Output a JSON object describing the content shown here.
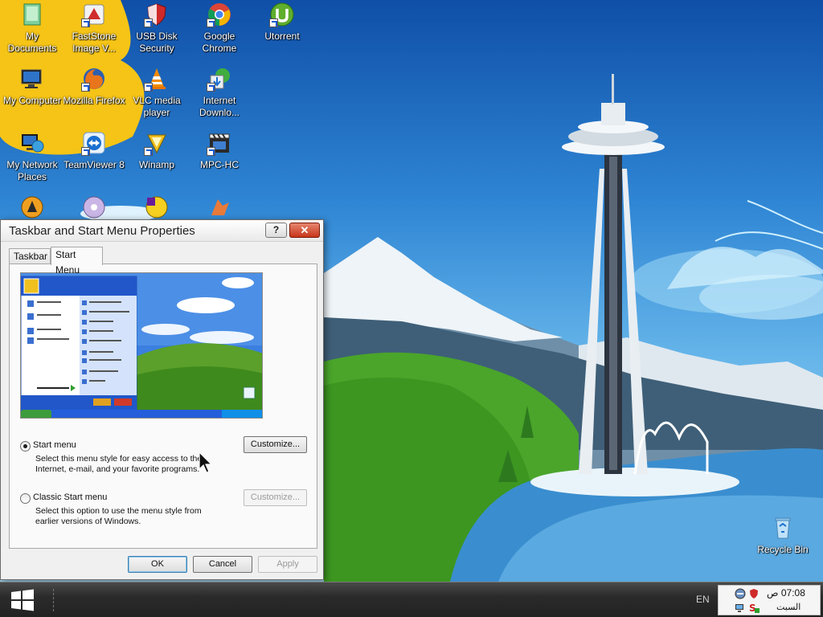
{
  "desktop": {
    "icons": [
      {
        "label": "My Documents"
      },
      {
        "label": "FastStone Image V..."
      },
      {
        "label": "USB Disk Security"
      },
      {
        "label": "Google Chrome"
      },
      {
        "label": "Utorrent"
      },
      {
        "label": "My Computer"
      },
      {
        "label": "Mozilla Firefox"
      },
      {
        "label": "VLC media player"
      },
      {
        "label": "Internet Downlo..."
      },
      {
        "label": "My Network Places"
      },
      {
        "label": "TeamViewer 8"
      },
      {
        "label": "Winamp"
      },
      {
        "label": "MPC-HC"
      },
      {
        "label": "Recycle Bin"
      }
    ]
  },
  "dialog": {
    "title": "Taskbar and Start Menu Properties",
    "help_label": "?",
    "close_label": "✕",
    "tabs": [
      {
        "label": "Taskbar"
      },
      {
        "label": "Start Menu"
      }
    ],
    "active_tab": "Start Menu",
    "options": {
      "start_menu": {
        "label": "Start menu",
        "description": "Select this menu style for easy access to the Internet, e-mail, and your favorite programs.",
        "selected": true,
        "customize_label": "Customize..."
      },
      "classic_start_menu": {
        "label": "Classic Start menu",
        "description": "Select this option to use the menu style from earlier versions of Windows.",
        "selected": false,
        "customize_label": "Customize..."
      }
    },
    "buttons": {
      "ok": "OK",
      "cancel": "Cancel",
      "apply": "Apply"
    }
  },
  "taskbar": {
    "language": "EN",
    "clock_time": "07:08 ص",
    "clock_day": "السبت"
  },
  "colors": {
    "titlebar_close": "#c7361b",
    "taskbar": "#2b2b2b",
    "dialog_bg": "#f0f0f0"
  }
}
